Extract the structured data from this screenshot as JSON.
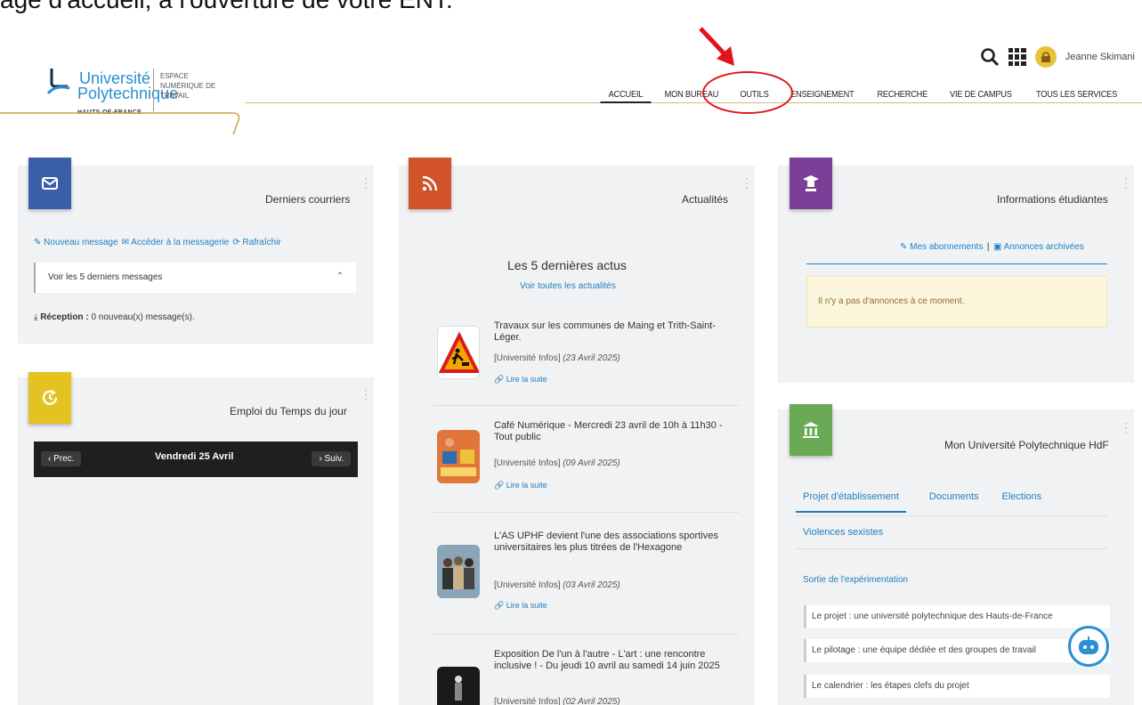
{
  "caption": "age d'accueil, à l'ouverture de votre ENT.",
  "logo": {
    "line1": "Université",
    "line2": "Polytechnique",
    "line3": "HAUTS-DE-FRANCE",
    "ent_text": "ESPACE NUMÉRIQUE DE TRAVAIL"
  },
  "topbar": {
    "user": "Jeanne Skimani",
    "search_icon": "search-icon",
    "apps_icon": "grid-icon",
    "avatar_icon": "lock-avatar-icon"
  },
  "nav": [
    {
      "label": "ACCUEIL",
      "active": true
    },
    {
      "label": "MON BUREAU",
      "active": false,
      "highlighted": true
    },
    {
      "label": "OUTILS",
      "active": false
    },
    {
      "label": "ENSEIGNEMENT",
      "active": false
    },
    {
      "label": "RECHERCHE",
      "active": false
    },
    {
      "label": "VIE DE CAMPUS",
      "active": false
    },
    {
      "label": "TOUS LES SERVICES",
      "active": false
    }
  ],
  "mail": {
    "title": "Derniers courriers",
    "color": "#3b5fa6",
    "actions": [
      "Nouveau message",
      "Accéder à la messagerie",
      "Rafraîchir"
    ],
    "dropdown": "Voir les 5 derniers messages",
    "reception_label": "Réception :",
    "reception_value": "0 nouveau(x) message(s)."
  },
  "schedule": {
    "title": "Emploi du Temps du jour",
    "color": "#e4c222",
    "prev": "Prec.",
    "date": "Vendredi 25 Avril",
    "next": "Suiv."
  },
  "news": {
    "title": "Actualités",
    "color": "#d2522a",
    "heading": "Les 5 dernières actus",
    "all_link": "Voir toutes les actualités",
    "read_more": "Lire la suite",
    "items": [
      {
        "title": "Travaux sur les communes de Maing et Trith-Saint-Léger.",
        "source": "[Université Infos]",
        "date": "(23 Avril 2025)"
      },
      {
        "title": "Café Numérique - Mercredi 23 avril de 10h à 11h30 - Tout public",
        "source": "[Université Infos]",
        "date": "(09 Avril 2025)"
      },
      {
        "title": "L'AS UPHF devient l'une des associations sportives universitaires les plus titrées de l'Hexagone",
        "source": "[Université Infos]",
        "date": "(03 Avril 2025)"
      },
      {
        "title": "Exposition De l'un à l'autre - L'art : une rencontre inclusive ! - Du jeudi 10 avril au samedi 14 juin 2025",
        "source": "[Université Infos]",
        "date": "(02 Avril 2025)"
      }
    ]
  },
  "students": {
    "title": "Informations étudiantes",
    "color": "#7b3f98",
    "subscriptions": "Mes abonnements",
    "separator": "|",
    "archived": "Annonces archivées",
    "empty": "Il n'y a pas d'annonces à ce moment."
  },
  "uphf": {
    "title": "Mon Université Polytechnique HdF",
    "color": "#6aaa55",
    "tabs": [
      "Projet d'établissement",
      "Documents",
      "Elections",
      "Violences sexistes"
    ],
    "section": "Sortie de l'expérimentation",
    "rows": [
      "Le projet : une université polytechnique des Hauts-de-France",
      "Le pilotage : une équipe dédiée et des groupes de travail",
      "Le calendrier : les étapes clefs du projet"
    ]
  }
}
